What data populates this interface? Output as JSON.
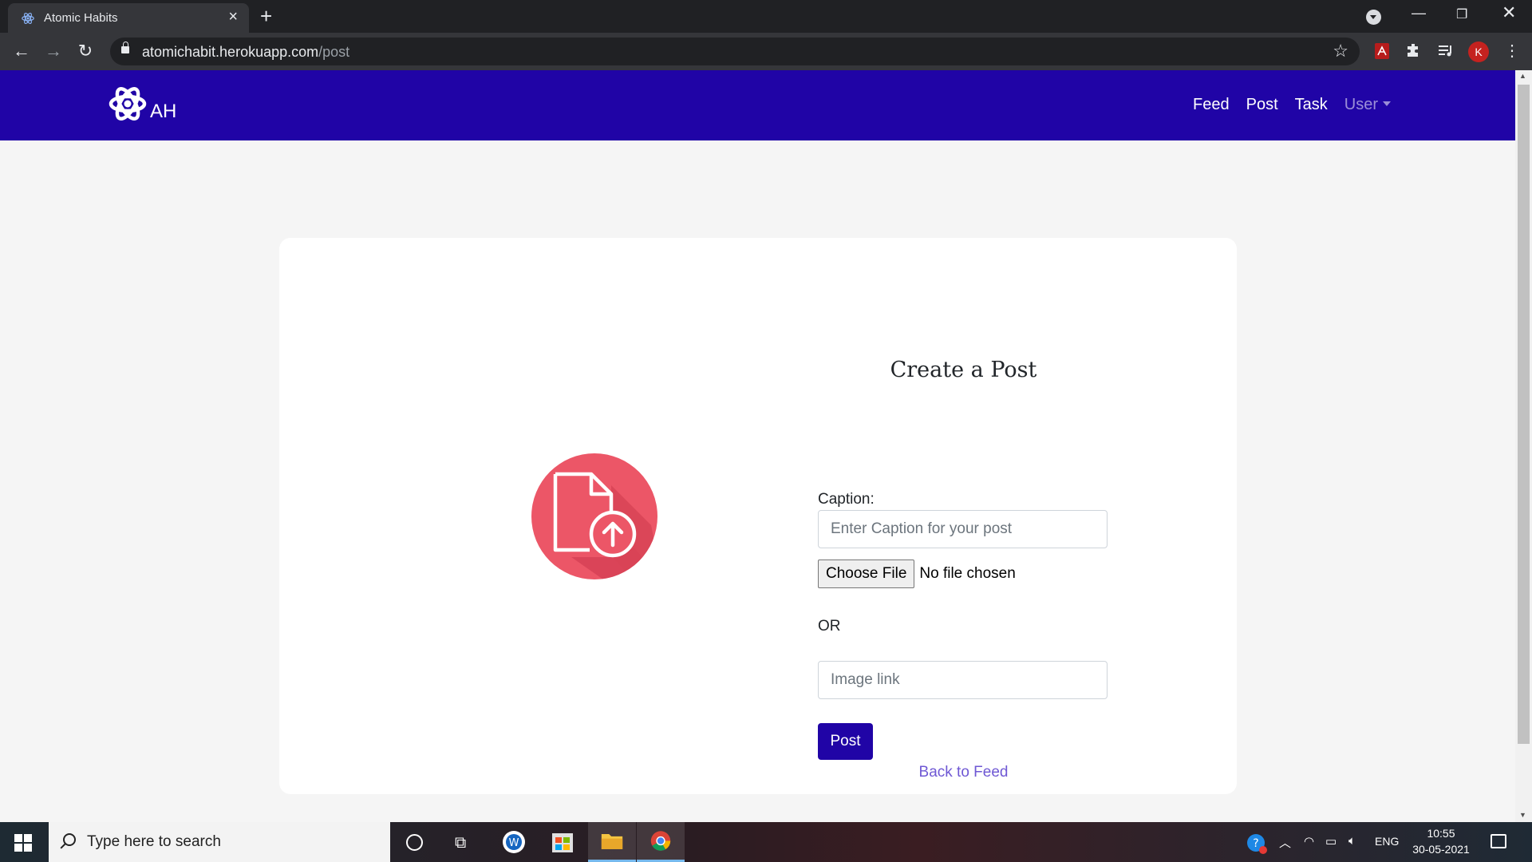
{
  "browser": {
    "tab_title": "Atomic Habits",
    "url_domain": "atomichabit.herokuapp.com",
    "url_path": "/post",
    "profile_initial": "K"
  },
  "site": {
    "brand_text": "AH",
    "brand_color": "#2004a6",
    "nav": [
      "Feed",
      "Post",
      "Task",
      "User"
    ]
  },
  "form": {
    "title": "Create a Post",
    "caption_label": "Caption:",
    "caption_placeholder": "Enter Caption for your post",
    "file_button": "Choose File",
    "file_status": "No file chosen",
    "or_text": "OR",
    "image_placeholder": "Image link",
    "submit_label": "Post",
    "back_link": "Back to Feed"
  },
  "illustration": {
    "icon": "file-upload-icon",
    "circle_color": "#ec5667"
  },
  "taskbar": {
    "search_placeholder": "Type here to search",
    "language": "ENG",
    "time": "10:55",
    "date": "30-05-2021"
  }
}
